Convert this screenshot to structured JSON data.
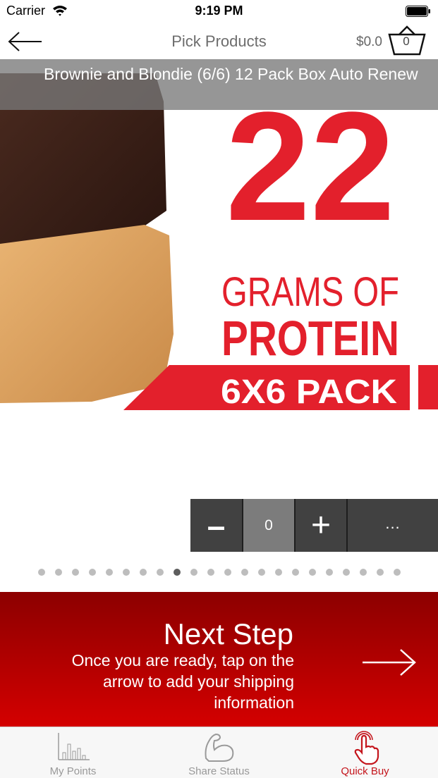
{
  "status_bar": {
    "carrier": "Carrier",
    "time": "9:19 PM"
  },
  "nav": {
    "title": "Pick Products",
    "cart_total": "$0.0",
    "cart_count": "0"
  },
  "product": {
    "name": "Brownie and Blondie (6/6) 12 Pack Box Auto Renew",
    "image_text": {
      "number": "22",
      "line1": "GRAMS OF",
      "line2": "PROTEIN",
      "line3": "6X6 PACK"
    }
  },
  "stepper": {
    "minus_label": "–",
    "quantity": "0",
    "plus_label": "+",
    "more_label": "..."
  },
  "pager": {
    "count": 22,
    "active_index": 8
  },
  "next_step": {
    "title": "Next Step",
    "description": "Once you are ready, tap on the arrow to add your shipping information"
  },
  "tabs": [
    {
      "label": "My Points",
      "icon": "bar-chart-icon",
      "active": false
    },
    {
      "label": "Share Status",
      "icon": "flexed-arm-icon",
      "active": false
    },
    {
      "label": "Quick Buy",
      "icon": "tap-hand-icon",
      "active": true
    }
  ],
  "colors": {
    "brand_red": "#c4151c",
    "banner_top": "#8c0000",
    "banner_bottom": "#d40000",
    "poster_red": "#e3202c"
  }
}
